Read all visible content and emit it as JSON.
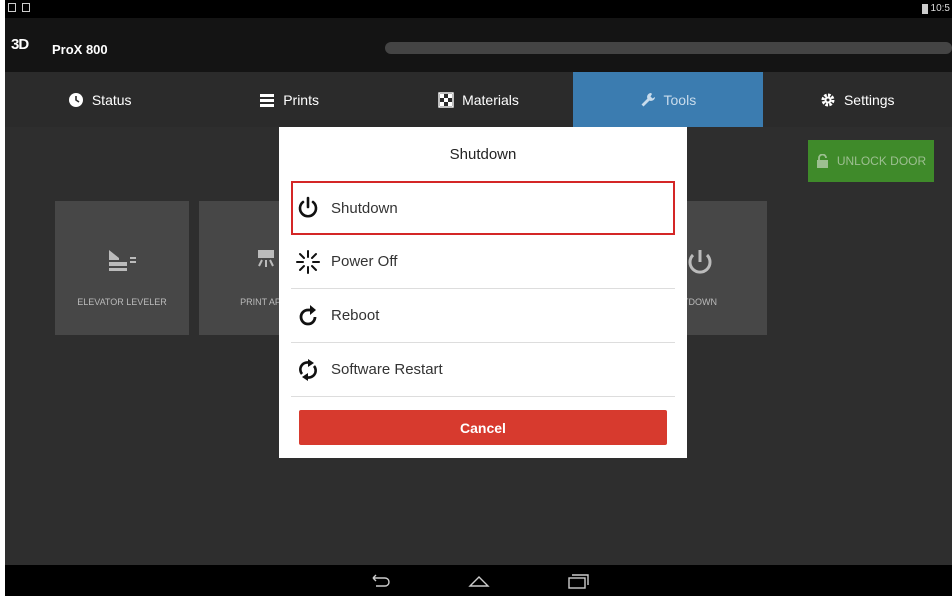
{
  "app": {
    "title": "ProX 800",
    "logo_text": "3D",
    "progress": 1.0
  },
  "statusbar": {
    "time": "10:5"
  },
  "tabs": [
    {
      "label": "Status",
      "icon": "clock-icon"
    },
    {
      "label": "Prints",
      "icon": "list-icon"
    },
    {
      "label": "Materials",
      "icon": "checkerboard-icon"
    },
    {
      "label": "Tools",
      "icon": "wrench-icon",
      "active": true
    },
    {
      "label": "Settings",
      "icon": "gear-icon"
    }
  ],
  "toolbar": {
    "unlock_label": "UNLOCK DOOR"
  },
  "tools": [
    {
      "label": "ELEVATOR LEVELER",
      "icon": "elevator-leveler-icon"
    },
    {
      "label": "PRINT APPL",
      "icon": "print-applicator-icon"
    },
    {
      "label": "TDOWN",
      "icon": "shutdown-icon"
    }
  ],
  "dialog": {
    "title": "Shutdown",
    "items": [
      {
        "label": "Shutdown",
        "icon": "power-icon"
      },
      {
        "label": "Power Off",
        "icon": "burst-icon"
      },
      {
        "label": "Reboot",
        "icon": "reboot-icon"
      },
      {
        "label": "Software Restart",
        "icon": "restart-icon"
      }
    ],
    "cancel_label": "Cancel"
  },
  "colors": {
    "accent": "#3b7cb0",
    "danger": "#d73a2e",
    "unlock": "#3f8a2a",
    "highlight": "#d42626"
  }
}
